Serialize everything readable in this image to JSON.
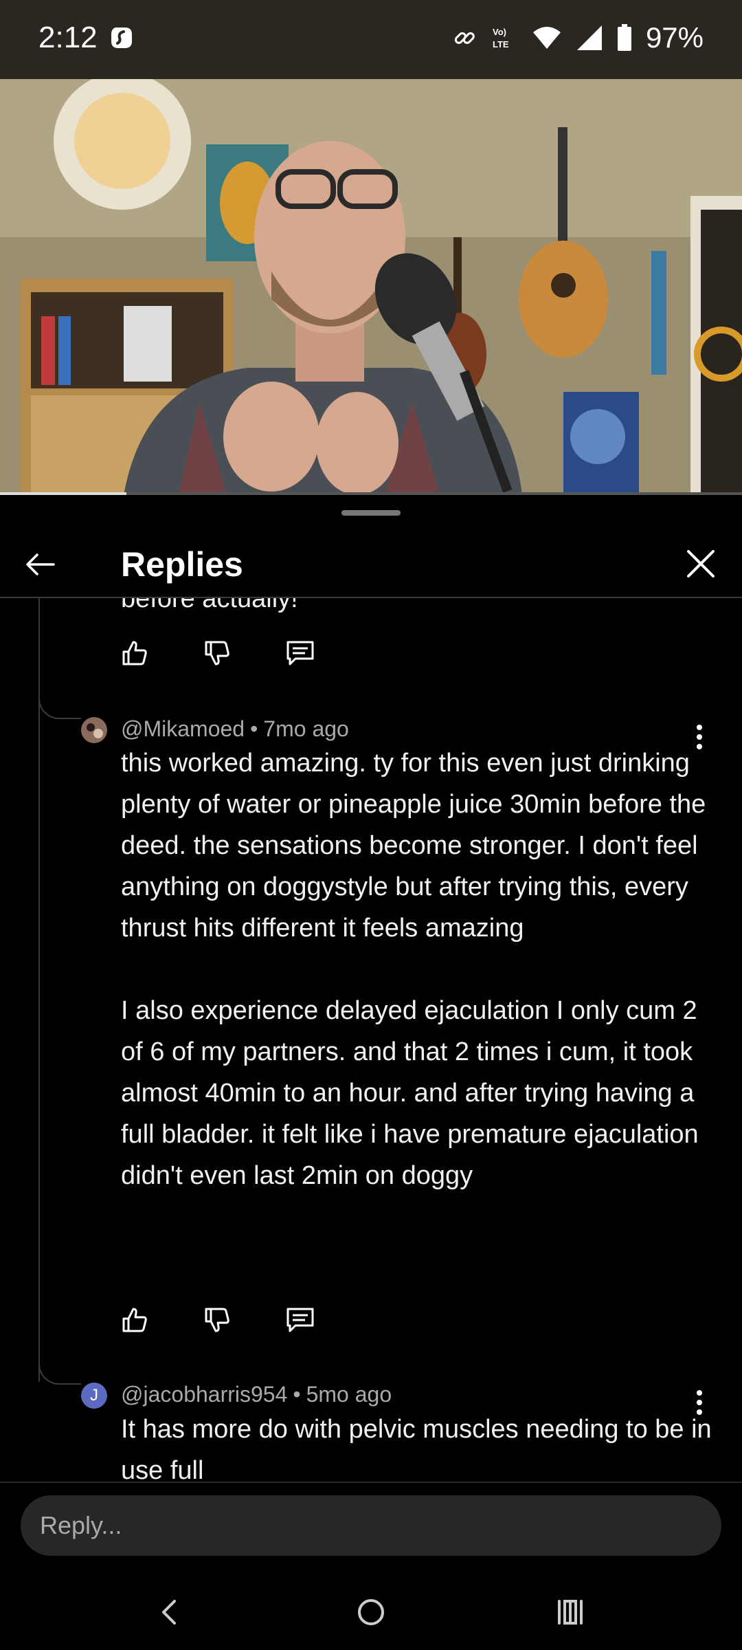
{
  "status_bar": {
    "time": "2:12",
    "battery": "97%",
    "icons": [
      "shazam-icon",
      "link-icon",
      "volte-icon",
      "wifi-icon",
      "signal-icon",
      "battery-icon"
    ]
  },
  "video": {
    "progress_percent": 17
  },
  "sheet": {
    "title": "Replies",
    "partial_text": "before actually!"
  },
  "replies": [
    {
      "author": "@Mikamoed",
      "age": "7mo ago",
      "text": "this worked amazing. ty for this even just drinking plenty of water or pineapple juice 30min before the deed. the sensations become stronger. I don't feel anything on doggystyle but after trying this, every thrust hits different it feels amazing\n\nI also experience delayed ejaculation I only cum 2 of 6 of my partners. and that 2 times i cum, it took almost 40min to an hour. and after trying having a full bladder. it felt like i have premature ejaculation didn't even last 2min on doggy"
    },
    {
      "author": "@jacobharris954",
      "age": "5mo ago",
      "avatar_letter": "J",
      "avatar_color": "#5c6bc0",
      "text": "It has more do with pelvic muscles needing to be in use full"
    }
  ],
  "reply_input": {
    "placeholder": "Reply..."
  },
  "colors": {
    "background": "#000000",
    "muted_text": "#aaaaaa",
    "divider": "#3a3a3a"
  }
}
